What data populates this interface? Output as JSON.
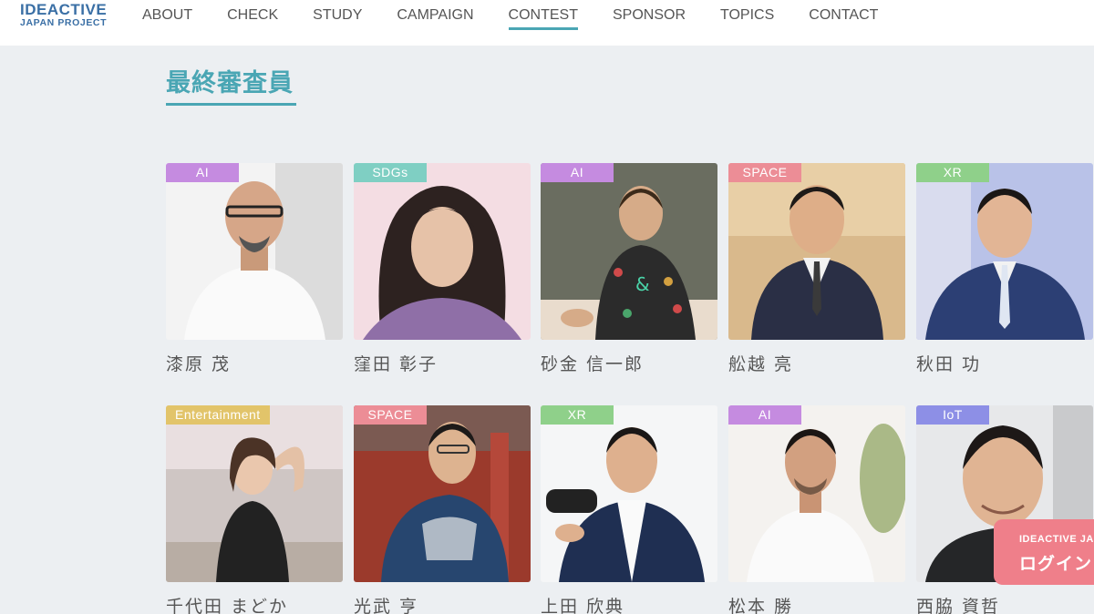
{
  "brand": {
    "line1": "IDEACTIVE",
    "line2": "JAPAN PROJECT"
  },
  "nav": [
    {
      "label": "ABOUT"
    },
    {
      "label": "CHECK"
    },
    {
      "label": "STUDY"
    },
    {
      "label": "CAMPAIGN"
    },
    {
      "label": "CONTEST",
      "active": true
    },
    {
      "label": "SPONSOR"
    },
    {
      "label": "TOPICS"
    },
    {
      "label": "CONTACT"
    }
  ],
  "section": {
    "title": "最終審査員"
  },
  "colors": {
    "accent": "#4aa6b4",
    "tag_ai": "#c58be0",
    "tag_sdgs": "#7fcfc3",
    "tag_space": "#ec8d96",
    "tag_xr": "#8fd08a",
    "tag_entertainment": "#e2c46a",
    "tag_iot": "#8d8fe6",
    "login": "#ef7f8a"
  },
  "judges": [
    {
      "tag": "AI",
      "name": "漆原 茂"
    },
    {
      "tag": "SDGs",
      "name": "窪田 彰子"
    },
    {
      "tag": "AI",
      "name": "砂金 信一郎"
    },
    {
      "tag": "SPACE",
      "name": "舩越 亮"
    },
    {
      "tag": "XR",
      "name": "秋田 功"
    },
    {
      "tag": "Entertainment",
      "name": "千代田 まどか"
    },
    {
      "tag": "SPACE",
      "name": "光武 亨"
    },
    {
      "tag": "XR",
      "name": "上田 欣典"
    },
    {
      "tag": "AI",
      "name": "松本 勝"
    },
    {
      "tag": "IoT",
      "name": "西脇 資哲"
    }
  ],
  "login": {
    "sub": "IDEACTIVE JA",
    "label": "ログイン"
  }
}
